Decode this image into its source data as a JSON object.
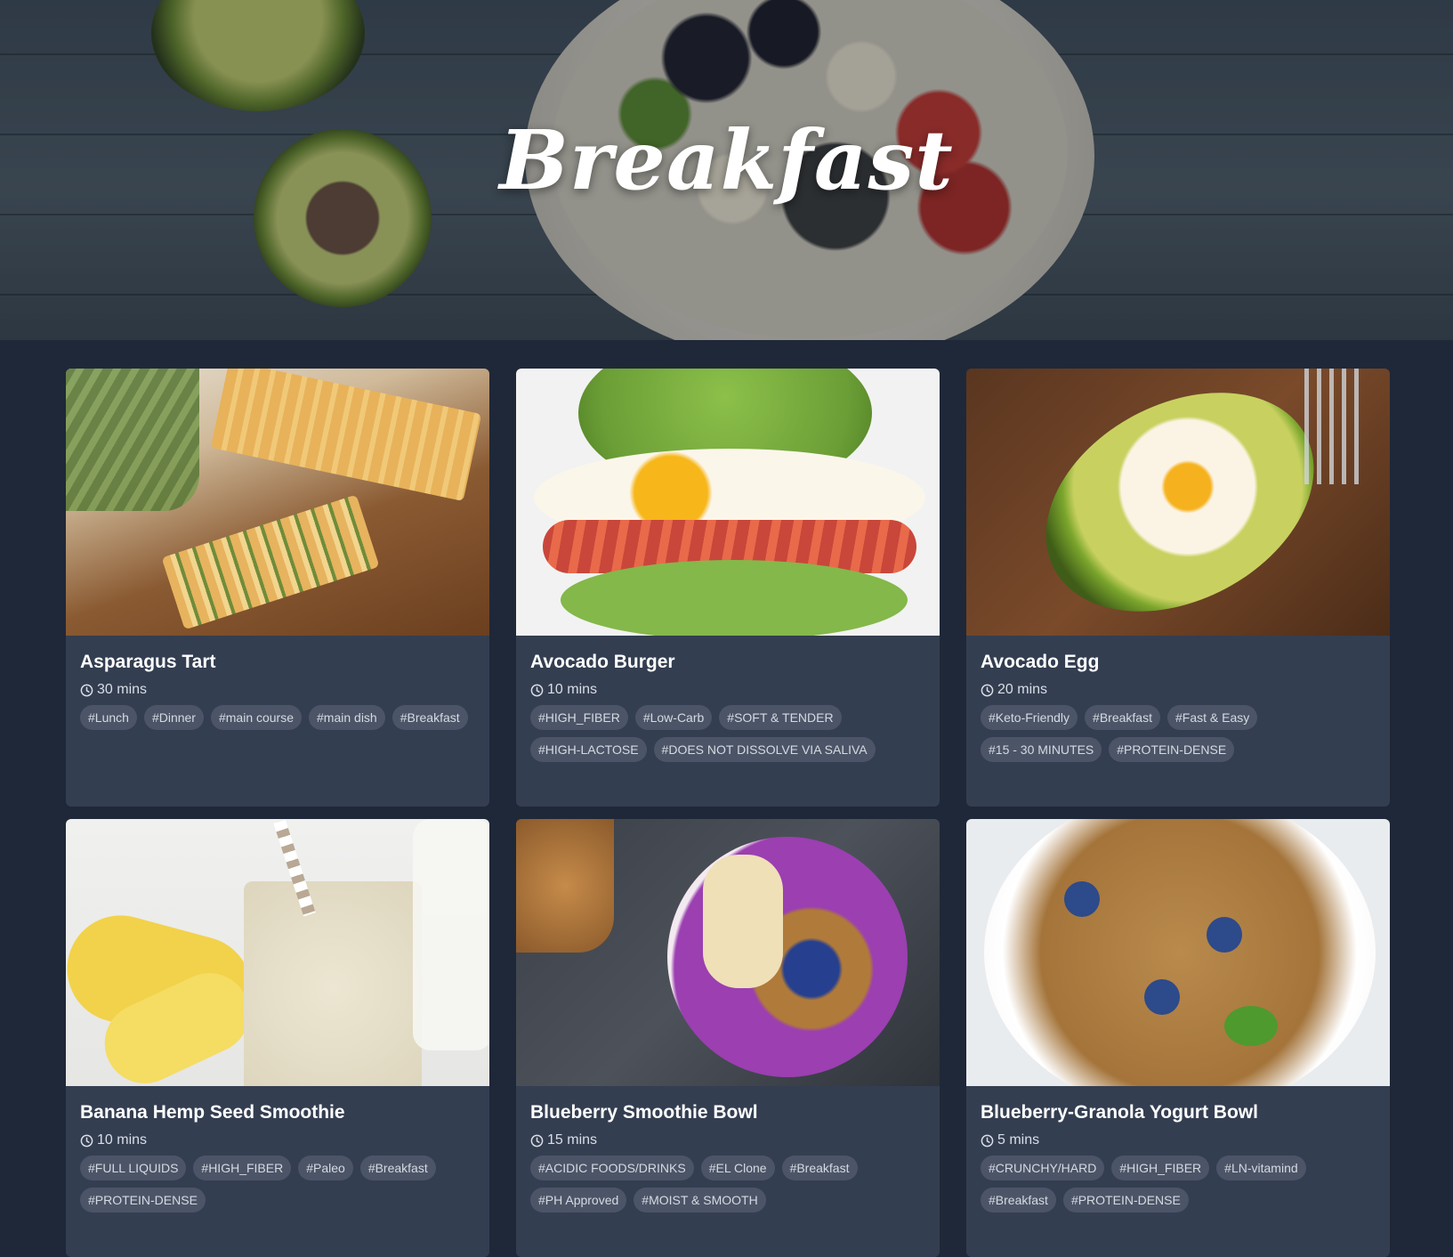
{
  "hero": {
    "title": "Breakfast"
  },
  "recipes": [
    {
      "name": "Asparagus Tart",
      "time": "30 mins",
      "tags": [
        "#Lunch",
        "#Dinner",
        "#main course",
        "#main dish",
        "#Breakfast"
      ]
    },
    {
      "name": "Avocado Burger",
      "time": "10 mins",
      "tags": [
        "#HIGH_FIBER",
        "#Low-Carb",
        "#SOFT & TENDER",
        "#HIGH-LACTOSE",
        "#DOES NOT DISSOLVE VIA SALIVA"
      ]
    },
    {
      "name": "Avocado Egg",
      "time": "20 mins",
      "tags": [
        "#Keto-Friendly",
        "#Breakfast",
        "#Fast & Easy",
        "#15 - 30 MINUTES",
        "#PROTEIN-DENSE"
      ]
    },
    {
      "name": "Banana Hemp Seed Smoothie",
      "time": "10 mins",
      "tags": [
        "#FULL LIQUIDS",
        "#HIGH_FIBER",
        "#Paleo",
        "#Breakfast",
        "#PROTEIN-DENSE"
      ]
    },
    {
      "name": "Blueberry Smoothie Bowl",
      "time": "15 mins",
      "tags": [
        "#ACIDIC FOODS/DRINKS",
        "#EL Clone",
        "#Breakfast",
        "#PH Approved",
        "#MOIST & SMOOTH"
      ]
    },
    {
      "name": "Blueberry-Granola Yogurt Bowl",
      "time": "5 mins",
      "tags": [
        "#CRUNCHY/HARD",
        "#HIGH_FIBER",
        "#LN-vitamind",
        "#Breakfast",
        "#PROTEIN-DENSE"
      ]
    }
  ],
  "icons": {
    "time": "clock-icon"
  },
  "colors": {
    "page_bg": "#1f2838",
    "card_bg": "#343e51",
    "tag_bg": "#4c5567"
  }
}
